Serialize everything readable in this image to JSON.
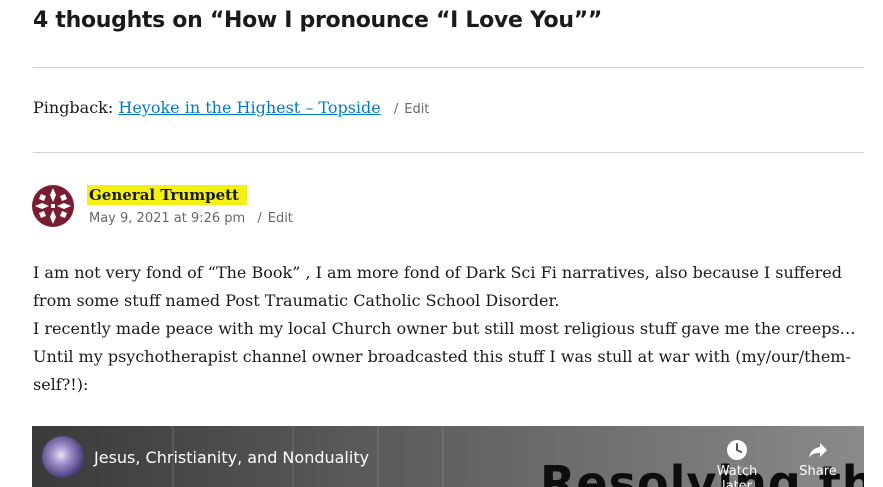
{
  "comments_title": "4 thoughts on “How I pronounce “I Love You””",
  "pingback": {
    "prefix": "Pingback:",
    "link_text": "Heyoke in the Highest – Topside",
    "separator": "/",
    "edit_label": "Edit"
  },
  "comment": {
    "author": "General Trumpett",
    "date": "May 9, 2021 at 9:26 pm",
    "separator": "/",
    "edit_label": "Edit",
    "highlight_color": "#f4f014",
    "body": [
      "I am not very fond of “The Book” , I am more fond of Dark Sci Fi narratives, also because I suffered from some stuff named Post Traumatic Catholic School Disorder.",
      "I recently made peace with my local Church owner but still most religious stuff gave me the creeps…",
      "Until my psychotherapist channel owner broadcasted this stuff I was stull at war with (my/our/them-self?!):"
    ]
  },
  "video": {
    "title": "Jesus, Christianity, and Nonduality",
    "thumbnail_text": "Resolving the",
    "watch_later_label": "Watch later",
    "share_label": "Share",
    "watch_later_icon": "clock-icon",
    "share_icon": "share-arrow-icon"
  },
  "colors": {
    "link": "#007acc",
    "meta": "#686868",
    "avatar_primary": "#7a1d34"
  }
}
